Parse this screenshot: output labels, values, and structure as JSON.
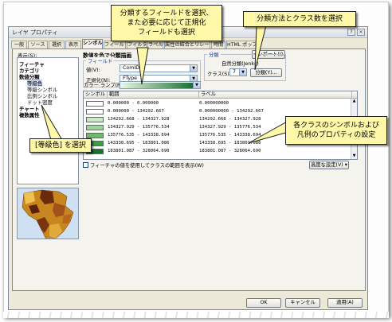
{
  "window": {
    "title": "レイヤ プロパティ",
    "help_btn": "?",
    "close_btn": "×"
  },
  "tabs": [
    "一般",
    "ソース",
    "選択",
    "表示",
    "シンボル",
    "フィールド",
    "フィルタ",
    "ラベル",
    "属性の結合とリレート",
    "時間",
    "HTML ポップアップ"
  ],
  "active_tab": "シンボル",
  "show": {
    "label": "表示(S):",
    "items": [
      {
        "label": "フィーチャ",
        "bold": true,
        "indent": 0
      },
      {
        "label": "カテゴリ",
        "bold": true,
        "indent": 0
      },
      {
        "label": "数値分類",
        "bold": true,
        "indent": 0
      },
      {
        "label": "等級色",
        "bold": false,
        "indent": 1,
        "selected": true
      },
      {
        "label": "等級シンボル",
        "bold": false,
        "indent": 1
      },
      {
        "label": "比例シンボル",
        "bold": false,
        "indent": 1
      },
      {
        "label": "ドット密度",
        "bold": false,
        "indent": 1
      },
      {
        "label": "チャート",
        "bold": true,
        "indent": 0
      },
      {
        "label": "複数属性",
        "bold": true,
        "indent": 0
      }
    ]
  },
  "symbology": {
    "section_title": "数値を色で分類描画",
    "import_btn": "インポート(I)...",
    "fields_group": "フィールド",
    "value_label": "値(V):",
    "value": "ComID",
    "normalize_label": "正規化(N):",
    "normalize": "FType",
    "color_ramp_label": "カラー ランプ(R):",
    "classification_group": "分類",
    "method": "自然分類(Jenks)",
    "classes_label": "クラス(S):",
    "classes": "7",
    "classify_btn": "分類(Y)..."
  },
  "table": {
    "headers": [
      "シンボル",
      "範囲",
      "ラベル"
    ],
    "rows": [
      {
        "color": "#ffffff",
        "range": "0.000000 - 0.000000",
        "label": "0.000000000"
      },
      {
        "color": "#ffffff",
        "range": "0.000000 - 134292.667",
        "label": "0.000000000 - 134292.667"
      },
      {
        "color": "#c9e6c6",
        "range": "134292.668 - 134327.928",
        "label": "134292.668 - 134327.928"
      },
      {
        "color": "#9fd29c",
        "range": "134327.929 - 135776.534",
        "label": "134327.929 - 135776.534"
      },
      {
        "color": "#6fb86c",
        "range": "135776.535 - 143338.694",
        "label": "135776.535 - 143338.694"
      },
      {
        "color": "#3f9a47",
        "range": "143338.695 - 183801.086",
        "label": "143338.695 - 183801.086"
      },
      {
        "color": "#1d6e33",
        "range": "183801.087 - 328064.690",
        "label": "183801.087 - 328064.690"
      }
    ],
    "show_range_check": "フィーチャの値を使用してクラスの範囲を表示(W)",
    "advanced_btn": "高度な設定(V) ▾"
  },
  "buttons": {
    "ok": "OK",
    "cancel": "キャンセル",
    "apply": "適用(A)"
  },
  "callouts": {
    "fields": [
      "分類するフィールドを選択、",
      "また必要に応じて正規化",
      "フィールドも選択"
    ],
    "method": "分類方法とクラス数を選択",
    "graduated": "[等級色] を選択",
    "symbols": [
      "各クラスのシンボルおよび",
      "凡例のプロパティの設定"
    ]
  },
  "colors": {
    "callout_bg": "#fff8a8",
    "ramp_start": "#e8f5e4",
    "ramp_end": "#1d6e33"
  }
}
